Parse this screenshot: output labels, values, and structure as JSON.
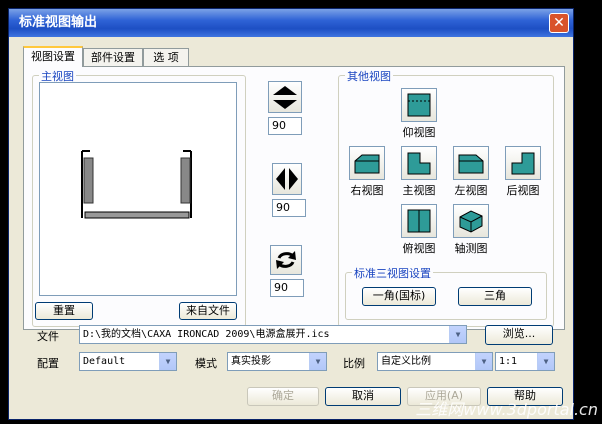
{
  "window": {
    "title": "标准视图输出",
    "close_icon": "close-icon"
  },
  "tabs": [
    "视图设置",
    "部件设置",
    "选  项"
  ],
  "main_view": {
    "label": "主视图",
    "reset": "重置",
    "from_file": "来自文件"
  },
  "rotation": {
    "vertical_value": "90",
    "horizontal_value": "90",
    "rotate_value": "90"
  },
  "other_views": {
    "label": "其他视图",
    "bottom": "仰视图",
    "right": "右视图",
    "front": "主视图",
    "left": "左视图",
    "back": "后视图",
    "top": "俯视图",
    "iso": "轴测图"
  },
  "standard_three": {
    "label": "标准三视图设置",
    "first_angle": "一角(国标)",
    "third_angle": "三角"
  },
  "file": {
    "label": "文件",
    "value": "D:\\我的文档\\CAXA IRONCAD 2009\\电源盒展开.ics",
    "browse": "浏览..."
  },
  "config": {
    "label": "配置",
    "value": "Default"
  },
  "mode": {
    "label": "模式",
    "value": "真实投影"
  },
  "scale": {
    "label": "比例",
    "value": "自定义比例",
    "ratio": "1:1"
  },
  "footer": {
    "ok": "确定",
    "cancel": "取消",
    "apply": "应用(A)",
    "help": "帮助"
  },
  "watermark": "三维网www.3dportal.cn",
  "colors": {
    "title_bar": "#2f63d6",
    "window_bg": "#ece9d8",
    "accent": "#1a45c0"
  }
}
